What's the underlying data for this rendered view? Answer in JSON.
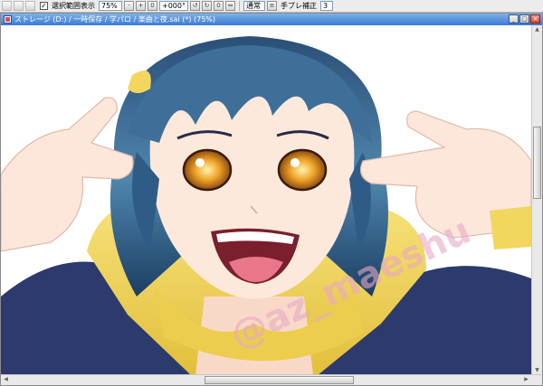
{
  "toolbar": {
    "show_selection_label": "選択範囲表示",
    "zoom_value": "75%",
    "rotation_value": "+000°",
    "blend_mode_value": "通常",
    "stabilizer_label": "手ブレ補正",
    "stabilizer_value": "3",
    "zoom_out_glyph": "-",
    "zoom_in_glyph": "+",
    "rotate_ccw_glyph": "↺",
    "rotate_cw_glyph": "↻",
    "reset_glyph": "0",
    "flip_glyph": "⇔"
  },
  "window": {
    "title": "ストレージ (D:) / 一時保存 / 学パロ / 楽曲と夜.sai (*) (75%)",
    "minimize_glyph": "_",
    "maximize_glyph": "□",
    "close_glyph": "×"
  },
  "canvas": {
    "watermark": "@az_maeshu",
    "colors": {
      "hair": "#3e6f99",
      "hair_dark": "#173a5e",
      "skin": "#fde9dc",
      "hoodie": "#f2d660",
      "jacket": "#2d3a6e",
      "eyes": "#e08a1a",
      "watermark": "#e7a9c3"
    }
  },
  "scrollbars": {
    "up_glyph": "▲",
    "down_glyph": "▼",
    "left_glyph": "◀",
    "right_glyph": "▶"
  }
}
